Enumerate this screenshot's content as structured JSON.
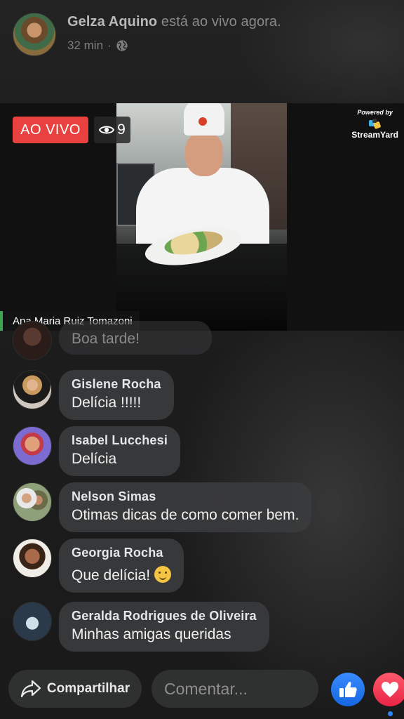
{
  "header": {
    "author_name": "Gelza Aquino",
    "status_text": "está ao vivo agora.",
    "time_ago": "32 min",
    "separator": "·",
    "privacy_icon": "globe-icon"
  },
  "video": {
    "live_label": "AO VIVO",
    "viewer_count": "9",
    "viewer_icon": "eye-icon",
    "overlay_powered_by": "Powered by",
    "overlay_brand": "StreamYard",
    "speaker_name": "Ana Maria Ruiz Tomazoni",
    "nameplate_color": "#3aa552",
    "live_color": "#e9413f"
  },
  "comments": [
    {
      "name": "",
      "text": "Boa tarde!",
      "faded": true
    },
    {
      "name": "Gislene Rocha",
      "text": "Delícia !!!!!"
    },
    {
      "name": "Isabel Lucchesi",
      "text": "Delícia"
    },
    {
      "name": "Nelson Simas",
      "text": "Otimas dicas de como comer bem."
    },
    {
      "name": "Georgia Rocha",
      "text": "Que delícia!",
      "emoji": "yum-emoji"
    },
    {
      "name": "Geralda Rodrigues de Oliveira",
      "text": "Minhas amigas queridas"
    }
  ],
  "bottom_bar": {
    "share_label": "Compartilhar",
    "share_icon": "share-arrow-icon",
    "comment_placeholder": "Comentar...",
    "like_icon": "thumbs-up-icon",
    "love_icon": "heart-icon",
    "like_color": "#1877f2",
    "love_color": "#f33e58"
  }
}
